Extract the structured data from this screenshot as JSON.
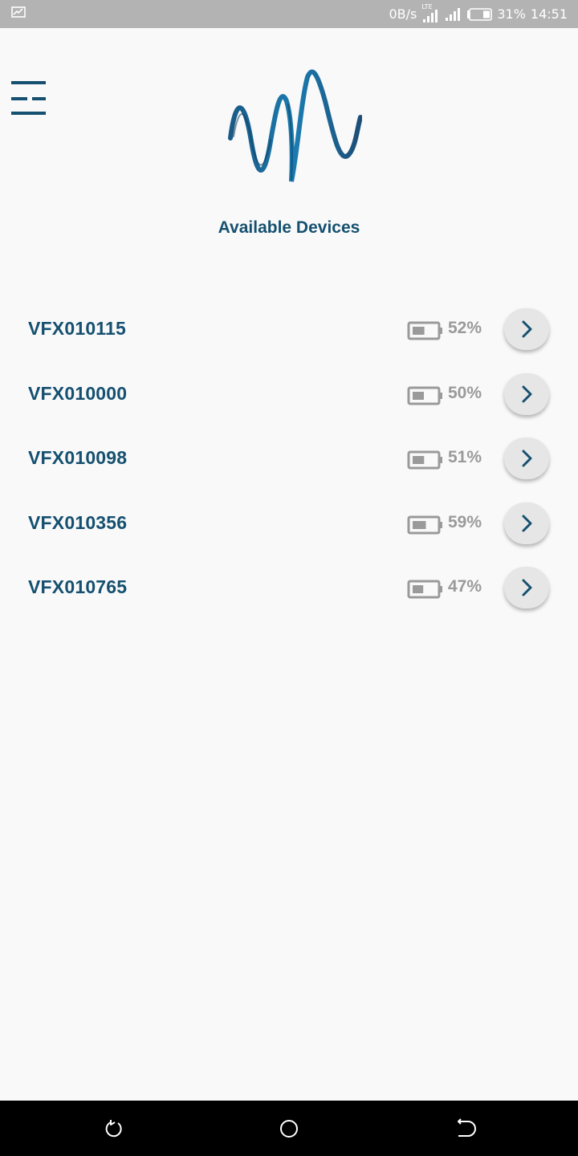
{
  "status_bar": {
    "net_speed": "0B/s",
    "network_type": "LTE",
    "battery_percent": "31%",
    "time": "14:51",
    "icons": [
      "screen-cast-icon",
      "signal-icon",
      "signal-icon",
      "battery-icon"
    ]
  },
  "header": {
    "menu_icon": "menu-icon",
    "logo": "wave-logo",
    "title": "Available Devices"
  },
  "devices": [
    {
      "name": "VFX010115",
      "battery": "52%",
      "level": 0.52
    },
    {
      "name": "VFX010000",
      "battery": "50%",
      "level": 0.5
    },
    {
      "name": "VFX010098",
      "battery": "51%",
      "level": 0.51
    },
    {
      "name": "VFX010356",
      "battery": "59%",
      "level": 0.59
    },
    {
      "name": "VFX010765",
      "battery": "47%",
      "level": 0.47
    }
  ],
  "navigation": {
    "buttons": [
      "back-icon",
      "home-icon",
      "recents-icon"
    ]
  },
  "colors": {
    "primary": "#155070",
    "muted": "#9a9a9a",
    "background": "#f9f9f9",
    "status_bar": "#b3b3b3"
  }
}
